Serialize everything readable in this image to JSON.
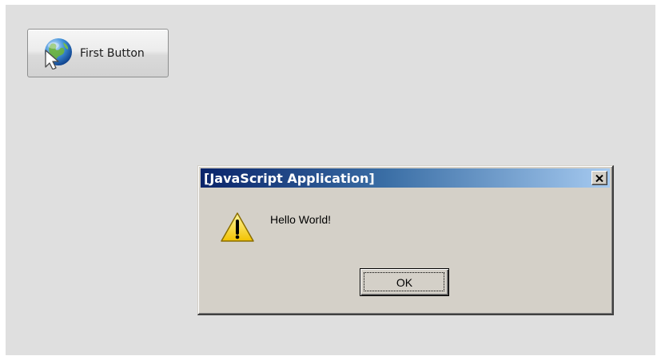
{
  "page": {
    "background_color": "#dfdfdf"
  },
  "first_button": {
    "label": "First Button",
    "icon": "globe-cursor-icon"
  },
  "dialog": {
    "title": "[JavaScript Application]",
    "message": "Hello World!",
    "ok_label": "OK",
    "close_icon": "close-icon",
    "warning_icon": "warning-icon",
    "title_bar_colors": [
      "#0a246a",
      "#a6caf0"
    ],
    "face_color": "#d4d0c8"
  }
}
